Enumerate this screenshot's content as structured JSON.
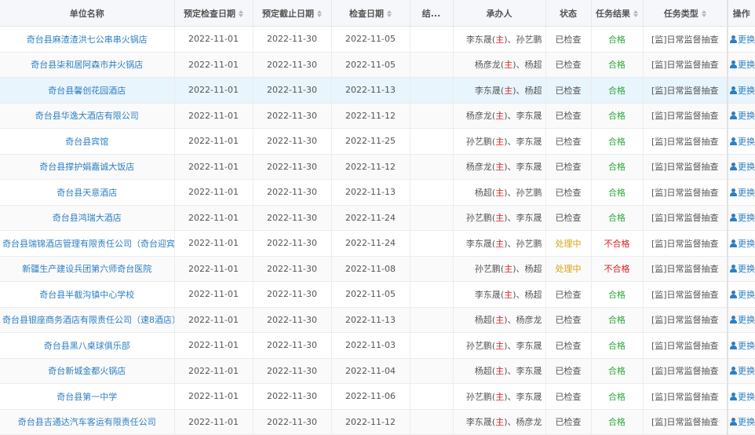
{
  "columns": {
    "unit": "单位名称",
    "plan_start": "预定检查日期",
    "plan_end": "预定截止日期",
    "check_date": "检查日期",
    "result_short": "结...",
    "handler": "承办人",
    "status": "状态",
    "task_result": "任务结果",
    "task_type": "任务类型",
    "operation": "操作"
  },
  "main_mark": "主",
  "operation_label": "更换",
  "rows": [
    {
      "unit": "奇台县麻渣渣洪七公串串火锅店",
      "start": "2022-11-01",
      "end": "2022-11-30",
      "check": "2022-11-05",
      "p1": "李东晟",
      "p2": "、孙艺鹏",
      "status": "已检查",
      "result": "合格",
      "type": "[监]日常监督抽查"
    },
    {
      "unit": "奇台县柒和居阿森市井火锅店",
      "start": "2022-11-01",
      "end": "2022-11-30",
      "check": "2022-11-05",
      "p1": "杨彦龙",
      "p2": "、杨超",
      "status": "已检查",
      "result": "合格",
      "type": "[监]日常监督抽查"
    },
    {
      "unit": "奇台县馨创花园酒店",
      "start": "2022-11-01",
      "end": "2022-11-30",
      "check": "2022-11-13",
      "p1": "李东晟",
      "p2": "、杨超",
      "status": "已检查",
      "result": "合格",
      "type": "[监]日常监督抽查"
    },
    {
      "unit": "奇台县华逸大酒店有限公司",
      "start": "2022-11-01",
      "end": "2022-11-30",
      "check": "2022-11-12",
      "p1": "杨彦龙",
      "p2": "、李东晟",
      "status": "已检查",
      "result": "合格",
      "type": "[监]日常监督抽查"
    },
    {
      "unit": "奇台县宾馆",
      "start": "2022-11-01",
      "end": "2022-11-30",
      "check": "2022-11-25",
      "p1": "孙艺鹏",
      "p2": "、李东晟",
      "status": "已检查",
      "result": "合格",
      "type": "[监]日常监督抽查"
    },
    {
      "unit": "奇台县撑护娟嘉诚大饭店",
      "start": "2022-11-01",
      "end": "2022-11-30",
      "check": "2022-11-12",
      "p1": "杨彦龙",
      "p2": "、李东晟",
      "status": "已检查",
      "result": "合格",
      "type": "[监]日常监督抽查"
    },
    {
      "unit": "奇台县天意酒店",
      "start": "2022-11-01",
      "end": "2022-11-30",
      "check": "2022-11-13",
      "p1": "杨超",
      "p2": "、孙艺鹏",
      "status": "已检查",
      "result": "合格",
      "type": "[监]日常监督抽查"
    },
    {
      "unit": "奇台县鸿瑞大酒店",
      "start": "2022-11-01",
      "end": "2022-11-30",
      "check": "2022-11-24",
      "p1": "孙艺鹏",
      "p2": "、李东晟",
      "status": "已检查",
      "result": "合格",
      "type": "[监]日常监督抽查"
    },
    {
      "unit": "奇台县瑞锦酒店管理有限责任公司（奇台迎宾",
      "start": "2022-11-01",
      "end": "2022-11-30",
      "check": "2022-11-24",
      "p1": "李东晟",
      "p2": "、孙艺鹏",
      "status": "处理中",
      "result": "不合格",
      "type": "[监]日常监督抽查"
    },
    {
      "unit": "新疆生产建设兵团第六师奇台医院",
      "start": "2022-11-01",
      "end": "2022-11-30",
      "check": "2022-11-08",
      "p1": "孙艺鹏",
      "p2": "、杨超",
      "status": "处理中",
      "result": "不合格",
      "type": "[监]日常监督抽查"
    },
    {
      "unit": "奇台县半截沟镇中心学校",
      "start": "2022-11-01",
      "end": "2022-11-30",
      "check": "2022-11-05",
      "p1": "李东晟",
      "p2": "、杨超",
      "status": "已检查",
      "result": "合格",
      "type": "[监]日常监督抽查"
    },
    {
      "unit": "奇台县银座商务酒店有限责任公司（速8酒店）",
      "start": "2022-11-01",
      "end": "2022-11-30",
      "check": "2022-11-13",
      "p1": "杨超",
      "p2": "、杨彦龙",
      "status": "已检查",
      "result": "合格",
      "type": "[监]日常监督抽查"
    },
    {
      "unit": "奇台县黑八桌球俱乐部",
      "start": "2022-11-01",
      "end": "2022-11-30",
      "check": "2022-11-03",
      "p1": "孙艺鹏",
      "p2": "、李东晟",
      "status": "已检查",
      "result": "合格",
      "type": "[监]日常监督抽查"
    },
    {
      "unit": "奇台新城金都火锅店",
      "start": "2022-11-01",
      "end": "2022-11-30",
      "check": "2022-11-04",
      "p1": "杨超",
      "p2": "、李东晟",
      "status": "已检查",
      "result": "合格",
      "type": "[监]日常监督抽查"
    },
    {
      "unit": "奇台县第一中学",
      "start": "2022-11-01",
      "end": "2022-11-30",
      "check": "2022-11-06",
      "p1": "孙艺鹏",
      "p2": "、李东晟",
      "status": "已检查",
      "result": "合格",
      "type": "[监]日常监督抽查"
    },
    {
      "unit": "奇台县吉通达汽车客运有限责任公司",
      "start": "2022-11-01",
      "end": "2022-11-30",
      "check": "2022-11-12",
      "p1": "李东晟",
      "p2": "、杨彦龙",
      "status": "已检查",
      "result": "合格",
      "type": "[监]日常监督抽查"
    }
  ],
  "selected_row": 2,
  "colors": {
    "link": "#2c7fc4",
    "pass": "#2eaa3a",
    "fail": "#d9211e",
    "processing": "#d9a30c",
    "main_mark": "#d9211e"
  }
}
